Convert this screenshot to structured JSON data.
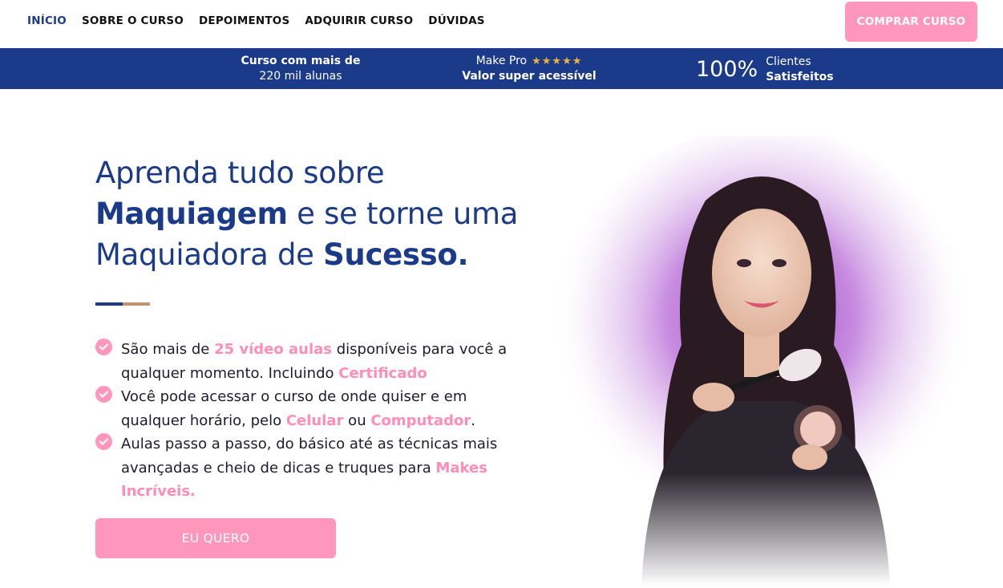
{
  "nav": {
    "items": [
      {
        "label": "INÍCIO",
        "active": true
      },
      {
        "label": "SOBRE O CURSO"
      },
      {
        "label": "DEPOIMENTOS"
      },
      {
        "label": "ADQUIRIR CURSO"
      },
      {
        "label": "DÚVIDAS"
      }
    ],
    "cta_label": "COMPRAR CURSO"
  },
  "info_strip": {
    "block1": {
      "line1": "Curso com mais de",
      "line2": "220 mil alunas"
    },
    "block2": {
      "line1": "Make Pro",
      "stars": "★★★★★",
      "rating": 5,
      "line2": "Valor super acessível"
    },
    "block3": {
      "number": "100%",
      "line1": "Clientes",
      "line2": "Satisfeitos"
    }
  },
  "hero": {
    "headline": {
      "part1": "Aprenda tudo sobre",
      "part2_bold": "Maquiagem",
      "part3": "e se torne uma",
      "part4": "Maquiadora de",
      "part5_bold": "Sucesso."
    },
    "features": [
      {
        "t1": "São mais de ",
        "h1": "25 vídeo aulas",
        "t2": " disponíveis para você a qualquer momento. Incluindo ",
        "h2": "Certificado",
        "t3": ""
      },
      {
        "t1": "Você pode acessar o curso de onde quiser e em qualquer horário, pelo ",
        "h1": "Celular",
        "t2": " ou ",
        "h2": "Computador",
        "t3": "."
      },
      {
        "t1": "Aulas passo a passo, do básico até as técnicas mais avançadas e cheio de dicas e truques para ",
        "h1": "Makes Incríveis.",
        "t2": "",
        "h2": "",
        "t3": ""
      }
    ],
    "cta_label": "EU QUERO"
  },
  "colors": {
    "brand_blue": "#1b3a8a",
    "accent_pink": "#ff96bb",
    "divider_tan": "#c8906d",
    "star_gold": "#f2b33a",
    "glow_purple": "#b565d6"
  },
  "icons": {
    "check": "check-circle-icon",
    "star": "star-icon"
  }
}
